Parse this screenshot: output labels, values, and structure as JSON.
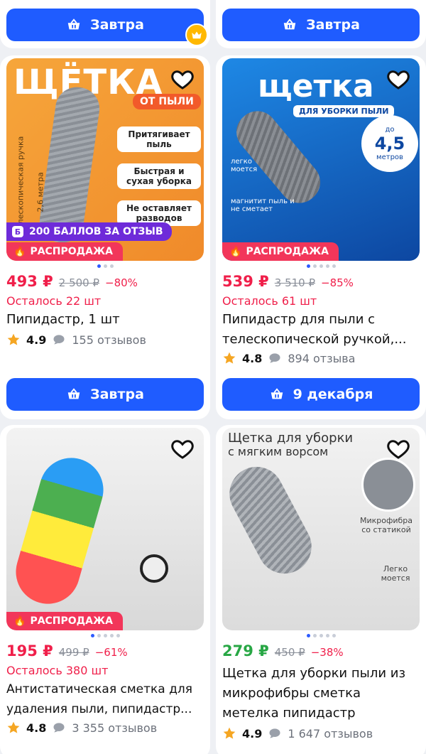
{
  "top_buttons": {
    "left": "Завтра",
    "right": "Завтра"
  },
  "products": [
    {
      "image_text": {
        "headline": "ЩЁТКА",
        "sub": "ОТ ПЫЛИ",
        "f1": "Притягивает пыль",
        "f2": "Быстрая и сухая уборка",
        "f3": "Не оставляет разводов",
        "handle": "телескопическая ручка",
        "len": "2,6 метра"
      },
      "points_badge": "200 БАЛЛОВ ЗА ОТЗЫВ",
      "sale_badge": "РАСПРОДАЖА",
      "price": "493 ₽",
      "old_price": "2 500 ₽",
      "discount": "−80%",
      "stock": "Осталось 22 шт",
      "title": "Пипидастр, 1 шт",
      "rating": "4.9",
      "reviews": "155 отзывов",
      "button": "Завтра"
    },
    {
      "image_text": {
        "headline": "щетка",
        "sub": "ДЛЯ УБОРКИ ПЫЛИ",
        "len_top": "до",
        "len_num": "4,5",
        "len_unit": "метров",
        "f1": "легко моется",
        "f2": "магнитит пыль и не сметает"
      },
      "sale_badge": "РАСПРОДАЖА",
      "price": "539 ₽",
      "old_price": "3 510 ₽",
      "discount": "−85%",
      "stock": "Осталось 61 шт",
      "title": "Пипидастр для пыли с телескопической ручкой,...",
      "rating": "4.8",
      "reviews": "894 отзыва",
      "button": "9 декабря"
    },
    {
      "sale_badge": "РАСПРОДАЖА",
      "price": "195 ₽",
      "old_price": "499 ₽",
      "discount": "−61%",
      "stock": "Осталось 380 шт",
      "title": "Антистатическая сметка для удаления пыли, пипидастр...",
      "rating": "4.8",
      "reviews": "3 355 отзывов"
    },
    {
      "image_text": {
        "headline": "Щетка для уборки",
        "sub": "с мягким ворсом",
        "f1": "Микрофибра со статикой",
        "f2": "Легко моется"
      },
      "price": "279 ₽",
      "old_price": "450 ₽",
      "discount": "−38%",
      "title": "Щетка для уборки пыли из микрофибры сметка метелка пипидастр",
      "rating": "4.9",
      "reviews": "1 647 отзывов"
    }
  ],
  "colors": {
    "accent": "#1f5cff",
    "sale": "#f2365a",
    "price_red": "#f01f4a",
    "price_green": "#28a745",
    "points": "#6e2bd9"
  }
}
